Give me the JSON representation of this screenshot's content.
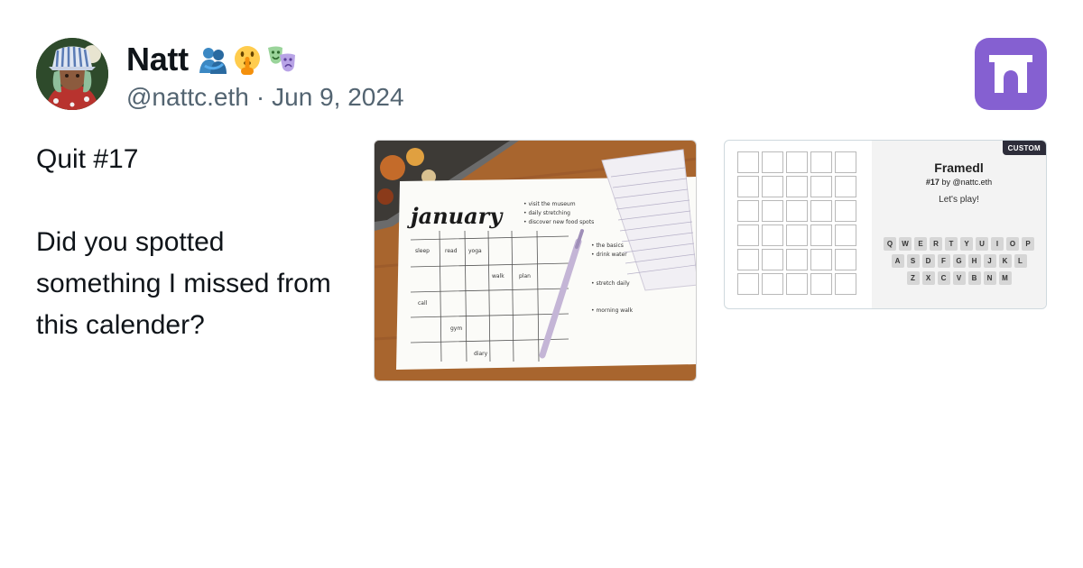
{
  "post": {
    "author_name": "Natt",
    "author_emojis": [
      "people-hugging",
      "shushing-face",
      "performing-arts"
    ],
    "handle": "@nattc.eth",
    "separator": "·",
    "date": "Jun 9, 2024",
    "text_lines": [
      "Quit #17",
      "",
      "Did you spotted something I missed from this calender?"
    ]
  },
  "app": {
    "icon": "frame-app-logo",
    "color": "#8560d1"
  },
  "embed_image": {
    "description_icon": "calendar-photo",
    "handwritten_title": "january"
  },
  "frame": {
    "badge": "CUSTOM",
    "title": "Framedl",
    "number": "#17",
    "by_text": "by @nattc.eth",
    "prompt": "Let's play!",
    "grid_rows": 6,
    "grid_cols": 5,
    "keyboard": [
      [
        "Q",
        "W",
        "E",
        "R",
        "T",
        "Y",
        "U",
        "I",
        "O",
        "P"
      ],
      [
        "A",
        "S",
        "D",
        "F",
        "G",
        "H",
        "J",
        "K",
        "L"
      ],
      [
        "Z",
        "X",
        "C",
        "V",
        "B",
        "N",
        "M"
      ]
    ]
  }
}
